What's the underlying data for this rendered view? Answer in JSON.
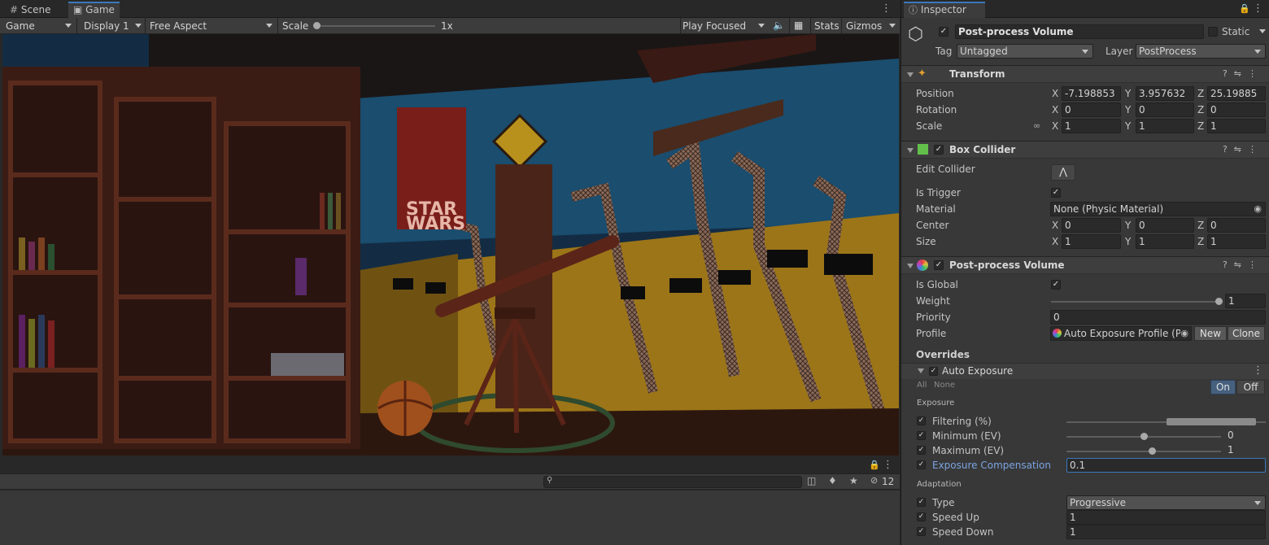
{
  "tabs": {
    "scene": "Scene",
    "game": "Game",
    "inspector": "Inspector"
  },
  "toolbar": {
    "view_mode": "Game",
    "display": "Display 1",
    "aspect": "Free Aspect",
    "scale_label": "Scale",
    "scale_value": "1x",
    "play_mode": "Play Focused",
    "stats": "Stats",
    "gizmos": "Gizmos"
  },
  "scene_text": {
    "poster_line1": "STAR",
    "poster_line2": "WARS"
  },
  "lower": {
    "hidden_count": "12"
  },
  "object": {
    "name": "Post-process Volume",
    "static_label": "Static",
    "tag_label": "Tag",
    "tag_value": "Untagged",
    "layer_label": "Layer",
    "layer_value": "PostProcess"
  },
  "transform": {
    "title": "Transform",
    "position_label": "Position",
    "rotation_label": "Rotation",
    "scale_label": "Scale",
    "pos": [
      "-7.198853",
      "3.957632",
      "25.19885"
    ],
    "rot": [
      "0",
      "0",
      "0"
    ],
    "scl": [
      "1",
      "1",
      "1"
    ],
    "x": "X",
    "y": "Y",
    "z": "Z"
  },
  "box_collider": {
    "title": "Box Collider",
    "edit_collider": "Edit Collider",
    "is_trigger": "Is Trigger",
    "material_label": "Material",
    "material_value": "None (Physic Material)",
    "center_label": "Center",
    "size_label": "Size",
    "center": [
      "0",
      "0",
      "0"
    ],
    "size": [
      "1",
      "1",
      "1"
    ]
  },
  "ppv": {
    "title": "Post-process Volume",
    "is_global": "Is Global",
    "weight_label": "Weight",
    "weight_value": "1",
    "weight_level": 1.0,
    "priority_label": "Priority",
    "priority_value": "0",
    "profile_label": "Profile",
    "profile_value": "Auto Exposure Profile (Po",
    "new_btn": "New",
    "clone_btn": "Clone",
    "overrides": "Overrides"
  },
  "auto_exposure": {
    "title": "Auto Exposure",
    "all": "All",
    "none": "None",
    "on": "On",
    "off": "Off",
    "exposure_section": "Exposure",
    "filtering": "Filtering (%)",
    "filtering_range": [
      50,
      95
    ],
    "minimum": "Minimum (EV)",
    "minimum_value": "0",
    "maximum": "Maximum (EV)",
    "maximum_value": "1",
    "compensation": "Exposure Compensation",
    "compensation_value": "0.1",
    "adaptation_section": "Adaptation",
    "type_label": "Type",
    "type_value": "Progressive",
    "speed_up": "Speed Up",
    "speed_up_value": "1",
    "speed_down": "Speed Down",
    "speed_down_value": "1"
  },
  "colors": {
    "accent": "#3a79bb",
    "selection_blue": "#7ba3e0"
  }
}
